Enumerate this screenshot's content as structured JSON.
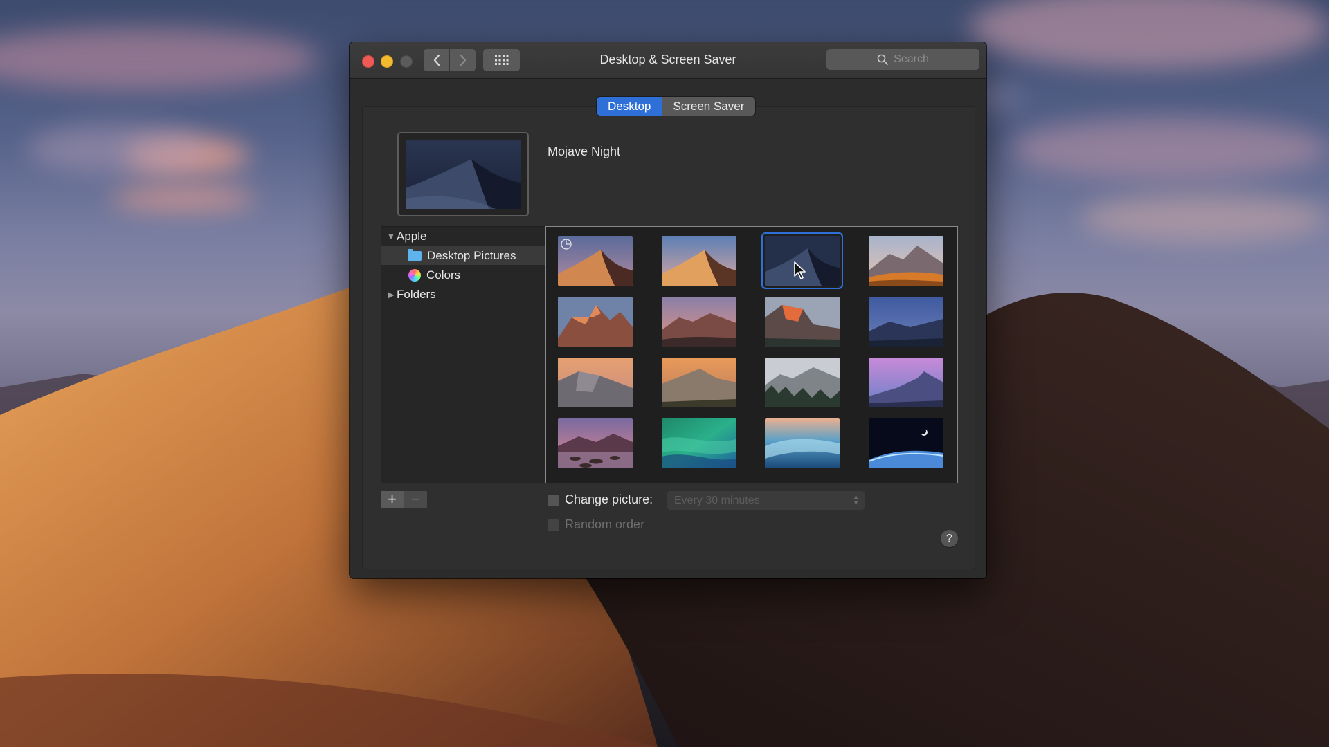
{
  "window": {
    "title": "Desktop & Screen Saver",
    "search_placeholder": "Search"
  },
  "tabs": [
    {
      "label": "Desktop",
      "selected": true
    },
    {
      "label": "Screen Saver",
      "selected": false
    }
  ],
  "current_wallpaper": {
    "name": "Mojave Night"
  },
  "sidebar": {
    "items": [
      {
        "label": "Apple",
        "expanded": true
      },
      {
        "label": "Desktop Pictures",
        "selected": true
      },
      {
        "label": "Colors"
      },
      {
        "label": "Folders",
        "expanded": false
      }
    ]
  },
  "options": {
    "change_picture_label": "Change picture:",
    "change_picture_checked": false,
    "interval_value": "Every 30 minutes",
    "random_order_label": "Random order",
    "random_order_checked": false
  },
  "buttons": {
    "add": "+",
    "remove": "−",
    "help": "?"
  },
  "colors": {
    "accent": "#2e70d8",
    "window_bg": "#2c2c2c",
    "close": "#ee5a55",
    "minimize": "#f4bb2f"
  }
}
